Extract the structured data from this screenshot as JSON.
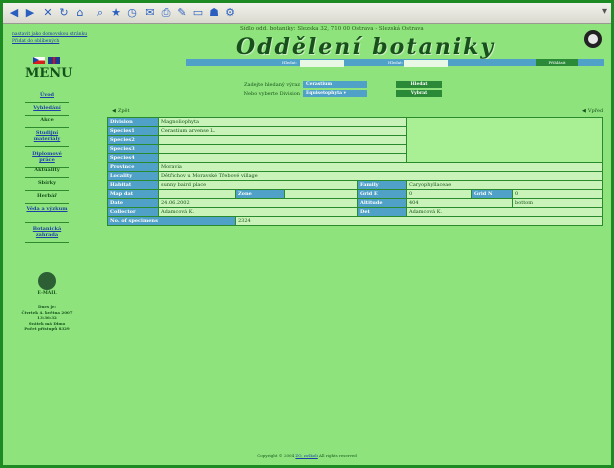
{
  "header": {
    "address": "Sídlo odd. botaniky: Slezska 32, 710 00 Ostrava - Slezská Ostrava",
    "title": "Oddělení botaniky",
    "links": [
      "nastavit jako domovskou stránku",
      "Přidat do oblíbených"
    ]
  },
  "searchbar": {
    "label1": "Hledat:",
    "label2": "Hledat:",
    "button": "Přihlásit"
  },
  "sidebar": {
    "menu_title": "MENU",
    "items": [
      {
        "label": "Úvod",
        "link": true
      },
      {
        "label": "Vyhledání",
        "link": true
      },
      {
        "label": "Akce",
        "link": false
      },
      {
        "label": "Studijní materiály",
        "link": true
      },
      {
        "label": "Diplomové práce",
        "link": true
      },
      {
        "label": "Aktuality",
        "link": false
      },
      {
        "label": "Sbírky",
        "link": false
      },
      {
        "label": "Herbář",
        "link": false
      },
      {
        "label": "Věda a výzkum",
        "link": true
      },
      {
        "label": "Botanická zahrada",
        "link": true
      }
    ],
    "email_label": "E-MAIL",
    "info": [
      "Dnes je:",
      "Čtvrtek 4. května 2007",
      "13:36:32",
      "Svátek má Dimo",
      "Počet přístupů 8329"
    ]
  },
  "search_form": {
    "label1": "Zadejte hledaný výraz",
    "field1": "Cerastium",
    "button1": "Hledat",
    "label2": "Nebo vyberte Division",
    "field2": "Equisetophyta",
    "button2": "Vybrat"
  },
  "nav": {
    "back": "Zpět",
    "up": "Vpřed"
  },
  "record": {
    "division_k": "Division",
    "division_v": "Magnoliophyta",
    "species1_k": "Species1",
    "species1_v": "Cerastium arvense L.",
    "species2_k": "Species2",
    "species3_k": "Species3",
    "species4_k": "Species4",
    "province_k": "Province",
    "province_v": "Moravia",
    "locality_k": "Locality",
    "locality_v": "Dětřichov u Moravské Třebové village",
    "habitat_k": "Habitat",
    "habitat_v": "sunny baird place",
    "family_k": "Family",
    "family_v": "Caryophyllaceae",
    "mapdat_k": "Map dat",
    "zone_k": "Zone",
    "gradE_k": "Grid E",
    "gradE_v": "0",
    "gradN_k": "Grid N",
    "gradN_v": "0",
    "date_k": "Date",
    "date_v": "24.06.2002",
    "altitude_k": "Altitude",
    "altitude_v": "404",
    "altitude_unit": "bottom",
    "collector_k": "Collector",
    "collector_v": "Adamcová K.",
    "det_k": "Det",
    "det_v": "Adamcová K.",
    "nos_k": "No. of specimens",
    "nos_v": "2324"
  },
  "footer": {
    "text": "Copyright © 2004",
    "link": "ZO, zoškoli",
    "rest": "All rights reserved"
  }
}
